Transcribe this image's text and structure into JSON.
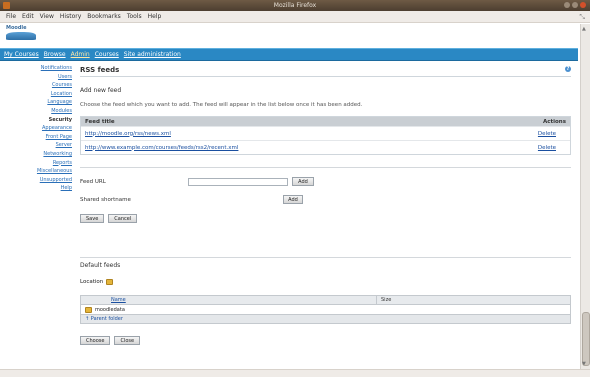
{
  "window": {
    "title": "Mozilla Firefox"
  },
  "menu": [
    "File",
    "Edit",
    "View",
    "History",
    "Bookmarks",
    "Tools",
    "Help"
  ],
  "logo": {
    "text": "Moodle"
  },
  "nav": [
    "My Courses",
    "Browse",
    "Admin",
    "Courses",
    "Site administration"
  ],
  "sidebar": {
    "items": [
      "Notifications",
      "Users",
      "Courses",
      "Location",
      "Language",
      "Modules",
      "Security",
      "Appearance",
      "Front Page",
      "Server",
      "Networking",
      "Reports",
      "Miscellaneous",
      "Unsupported",
      "Help"
    ]
  },
  "main": {
    "section_title": "RSS feeds",
    "subhead": "Add new feed",
    "description": "Choose the feed which you want to add. The feed will appear in the list below once it has been added.",
    "table": {
      "col_feed": "Feed title",
      "col_action": "Actions",
      "rows": [
        {
          "title": "http://moodle.org/rss/news.xml",
          "action": "Delete"
        },
        {
          "title": "http://www.example.com/courses/feeds/rss2/recent.xml",
          "action": "Delete"
        }
      ]
    },
    "form": {
      "url_label": "Feed URL",
      "url_value": "",
      "browse_label": "Add",
      "file_label": "Shared shortname",
      "file_button": "Add"
    },
    "buttons": {
      "save": "Save",
      "cancel": "Cancel"
    },
    "browse_section": {
      "title": "Default feeds",
      "folder_label": "Location",
      "col_name": "Name",
      "col_size": "Size",
      "folder_row": "moodledata",
      "up_link": "Parent folder"
    },
    "bottom_buttons": {
      "choose": "Choose",
      "close": "Close"
    }
  }
}
